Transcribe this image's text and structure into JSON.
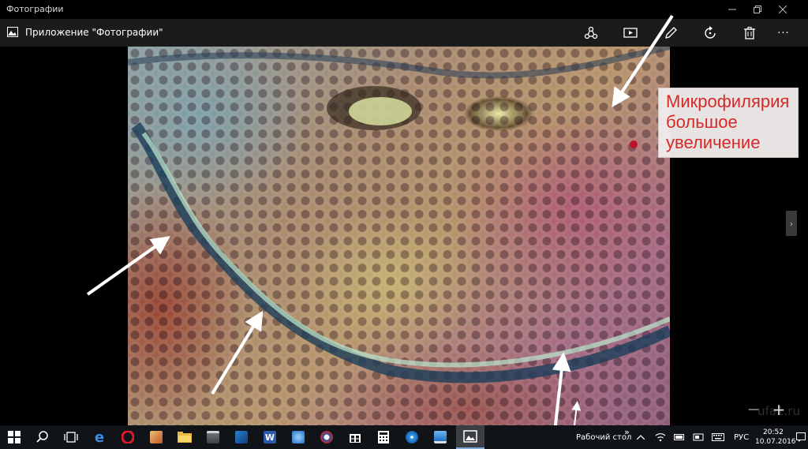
{
  "window": {
    "title": "Фотографии"
  },
  "appbar": {
    "title": "Приложение \"Фотографии\"",
    "tools": [
      {
        "icon": "share-icon"
      },
      {
        "icon": "slideshow-icon"
      },
      {
        "icon": "edit-pencil-icon"
      },
      {
        "icon": "rotate-icon"
      },
      {
        "icon": "delete-icon"
      },
      {
        "icon": "more-icon",
        "label": "···"
      }
    ]
  },
  "photo": {
    "annotation_lines": [
      "Микрофилярия",
      "большое",
      "увеличение"
    ],
    "annotation_color": "#d42a2a"
  },
  "zoom": {
    "minus": "—",
    "plus": "+"
  },
  "nav": {
    "next": "›"
  },
  "taskbar": {
    "apps": [
      {
        "icon": "start-windows-icon"
      },
      {
        "icon": "search-icon"
      },
      {
        "icon": "task-view-icon"
      },
      {
        "icon": "edge-icon"
      },
      {
        "icon": "opera-icon"
      },
      {
        "icon": "paint-icon"
      },
      {
        "icon": "file-explorer-icon"
      },
      {
        "icon": "movie-clapper-icon"
      },
      {
        "icon": "installer-icon"
      },
      {
        "icon": "word-icon"
      },
      {
        "icon": "audio-icon"
      },
      {
        "icon": "media-icon"
      },
      {
        "icon": "store-icon"
      },
      {
        "icon": "calculator-icon"
      },
      {
        "icon": "disc-icon"
      },
      {
        "icon": "remote-desktop-icon"
      },
      {
        "icon": "photos-icon"
      }
    ],
    "desktop_label": "Рабочий стол",
    "desktop_chevron": "»",
    "language": "РУС",
    "time": "20:52",
    "date": "10.07.2016"
  },
  "watermark": "ufa1.ru",
  "colors": {
    "appbar_bg": "#1b1b1b",
    "taskbar_bg": "#101418",
    "accent": "#7fa9d8"
  }
}
